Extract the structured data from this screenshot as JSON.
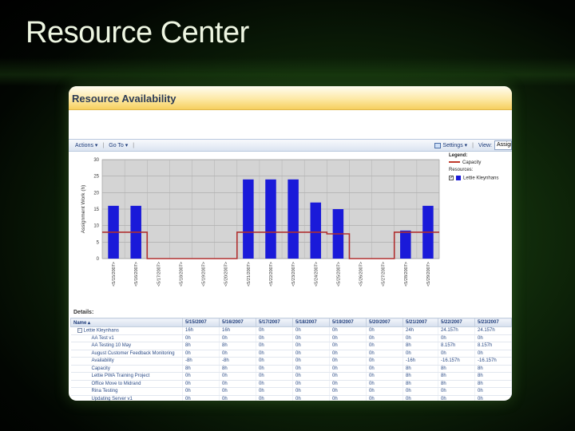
{
  "slide": {
    "title": "Resource Center"
  },
  "panel": {
    "title": "Resource Availability"
  },
  "toolbar": {
    "actions": "Actions ▾",
    "goto": "Go To ▾",
    "separator": "|",
    "settings": "Settings ▾",
    "view_label": "View:",
    "view_value": "Assign"
  },
  "legend": {
    "title": "Legend:",
    "capacity": "Capacity",
    "resources_title": "Resources:",
    "resource_name": "Lettie Kleynhans",
    "checkbox_mark": "✓"
  },
  "chart_data": {
    "type": "bar",
    "ylabel": "Assignment Work (h)",
    "categories": [
      "<5/15/2007>",
      "<5/16/2007>",
      "<5/17/2007>",
      "<5/18/2007>",
      "<5/19/2007>",
      "<5/20/2007>",
      "<5/21/2007>",
      "<5/22/2007>",
      "<5/23/2007>",
      "<5/24/2007>",
      "<5/25/2007>",
      "<5/26/2007>",
      "<5/27/2007>",
      "<5/28/2007>",
      "<5/29/2007>"
    ],
    "series": [
      {
        "name": "Lettie Kleynhans",
        "values": [
          16,
          16,
          0,
          0,
          0,
          0,
          24,
          24,
          24,
          17,
          15,
          0,
          0,
          8.5,
          16
        ]
      },
      {
        "name": "Capacity",
        "values": [
          8,
          8,
          0,
          0,
          0,
          0,
          8,
          8,
          8,
          8,
          7.5,
          0,
          0,
          8,
          8
        ]
      }
    ],
    "ylim": [
      0,
      30
    ],
    "yticks": [
      0,
      5,
      10,
      15,
      20,
      25,
      30
    ],
    "colors": {
      "bars": "#1a1ad9",
      "capacity": "#b03030",
      "plot_bg": "#d4d4d4"
    },
    "grid": true,
    "legend_position": "right"
  },
  "details": {
    "label": "Details:",
    "columns": [
      "Name ▴",
      "5/15/2007",
      "5/16/2007",
      "5/17/2007",
      "5/18/2007",
      "5/19/2007",
      "5/20/2007",
      "5/21/2007",
      "5/22/2007",
      "5/23/2007"
    ],
    "rows": [
      {
        "kind": "parent",
        "expander": "−",
        "cells": [
          "Lettie Kleynhans",
          "16h",
          "16h",
          "0h",
          "0h",
          "0h",
          "0h",
          "24h",
          "24.157h",
          "24.157h"
        ]
      },
      {
        "kind": "child",
        "cells": [
          "AA Test v1",
          "0h",
          "0h",
          "0h",
          "0h",
          "0h",
          "0h",
          "0h",
          "0h",
          "0h"
        ]
      },
      {
        "kind": "child",
        "cells": [
          "AA Testing 10 May",
          "8h",
          "8h",
          "0h",
          "0h",
          "0h",
          "0h",
          "8h",
          "8.157h",
          "8.157h"
        ]
      },
      {
        "kind": "child",
        "cells": [
          "August Customer Feedback Monitoring",
          "0h",
          "0h",
          "0h",
          "0h",
          "0h",
          "0h",
          "0h",
          "0h",
          "0h"
        ]
      },
      {
        "kind": "child",
        "cells": [
          "Availability",
          "-8h",
          "-8h",
          "0h",
          "0h",
          "0h",
          "0h",
          "-16h",
          "-16.157h",
          "-16.157h"
        ]
      },
      {
        "kind": "child",
        "cells": [
          "Capacity",
          "8h",
          "8h",
          "0h",
          "0h",
          "0h",
          "0h",
          "8h",
          "8h",
          "8h"
        ]
      },
      {
        "kind": "child",
        "cells": [
          "Lettie PWA Training Project",
          "0h",
          "0h",
          "0h",
          "0h",
          "0h",
          "0h",
          "8h",
          "8h",
          "8h"
        ]
      },
      {
        "kind": "child",
        "cells": [
          "Office Move to Midrand",
          "0h",
          "0h",
          "0h",
          "0h",
          "0h",
          "0h",
          "8h",
          "8h",
          "8h"
        ]
      },
      {
        "kind": "child",
        "cells": [
          "Rina Testing",
          "0h",
          "0h",
          "0h",
          "0h",
          "0h",
          "0h",
          "0h",
          "0h",
          "0h"
        ]
      },
      {
        "kind": "child",
        "cells": [
          "Updating Server v1",
          "0h",
          "0h",
          "0h",
          "0h",
          "0h",
          "0h",
          "0h",
          "0h",
          "0h"
        ]
      }
    ]
  }
}
